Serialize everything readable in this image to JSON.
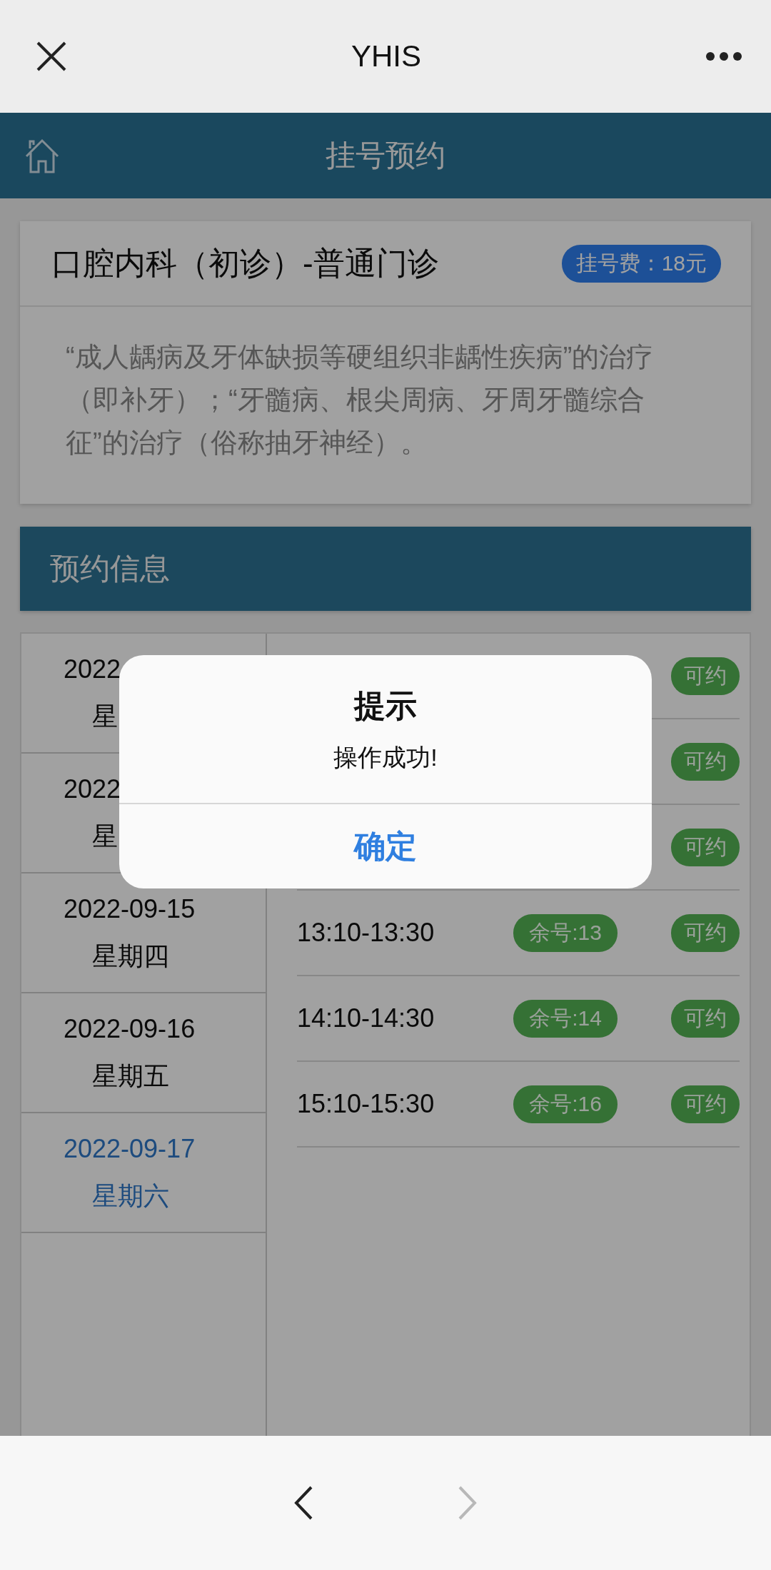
{
  "nav": {
    "title": "YHIS"
  },
  "header": {
    "title": "挂号预约"
  },
  "department": {
    "name": "口腔内科（初诊）-普通门诊",
    "fee": "挂号费：18元",
    "description": "“成人龋病及牙体缺损等硬组织非龋性疾病”的治疗（即补牙）；“牙髓病、根尖周病、牙周牙髓综合征”的治疗（俗称抽牙神经）。"
  },
  "section": {
    "title": "预约信息"
  },
  "dates": [
    {
      "date": "2022",
      "weekday": "星",
      "selected": false
    },
    {
      "date": "2022",
      "weekday": "星",
      "selected": false
    },
    {
      "date": "2022-09-15",
      "weekday": "星期四",
      "selected": false
    },
    {
      "date": "2022-09-16",
      "weekday": "星期五",
      "selected": false
    },
    {
      "date": "2022-09-17",
      "weekday": "星期六",
      "selected": true
    }
  ],
  "slots": [
    {
      "status": "可约"
    },
    {
      "status": "可约"
    },
    {
      "status": "可约"
    },
    {
      "time": "13:10-13:30",
      "remaining": "余号:13",
      "status": "可约"
    },
    {
      "time": "14:10-14:30",
      "remaining": "余号:14",
      "status": "可约"
    },
    {
      "time": "15:10-15:30",
      "remaining": "余号:16",
      "status": "可约"
    }
  ],
  "dialog": {
    "title": "提示",
    "message": "操作成功!",
    "button": "确定"
  },
  "bottom_nav": {
    "back": {
      "disabled": false
    },
    "forward": {
      "disabled": true
    }
  }
}
